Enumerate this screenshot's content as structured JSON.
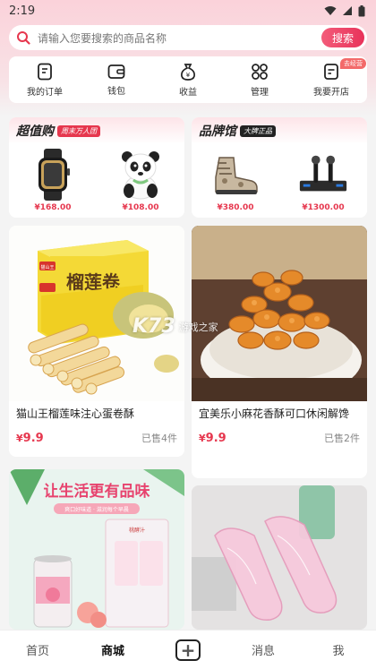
{
  "status": {
    "time": "2:19"
  },
  "search": {
    "placeholder": "请输入您要搜索的商品名称",
    "button": "搜索"
  },
  "menu": [
    {
      "label": "我的订单",
      "icon": "order-icon"
    },
    {
      "label": "钱包",
      "icon": "wallet-icon"
    },
    {
      "label": "收益",
      "icon": "money-bag-icon"
    },
    {
      "label": "管理",
      "icon": "grid-icon"
    },
    {
      "label": "我要开店",
      "icon": "shop-icon",
      "badge": "去经营"
    }
  ],
  "promos": [
    {
      "title": "超值购",
      "tag": "周末万人团",
      "items": [
        {
          "name": "smartwatch",
          "price": "¥168.00"
        },
        {
          "name": "panda-plush",
          "price": "¥108.00"
        }
      ]
    },
    {
      "title": "品牌馆",
      "tag": "大牌正品",
      "items": [
        {
          "name": "boots",
          "price": "¥380.00"
        },
        {
          "name": "microphone-set",
          "price": "¥1300.00"
        }
      ]
    }
  ],
  "products": [
    {
      "title": "猫山王榴莲味注心蛋卷酥",
      "price_symbol": "¥",
      "price": "9.9",
      "sold": "已售4件",
      "box_text": "榴莲卷",
      "brand_mark": "猫山王"
    },
    {
      "title": "宜美乐小麻花香酥可口休闲解馋",
      "price_symbol": "¥",
      "price": "9.9",
      "sold": "已售2件"
    },
    {
      "banner": "让生活更有品味",
      "tagline": "爽口好味道 · 滋润每个早晨",
      "can_brand": "桃酵汁"
    },
    {}
  ],
  "watermark": {
    "logo": "K73",
    "text": "游戏之家"
  },
  "tabs": [
    {
      "label": "首页"
    },
    {
      "label": "商城",
      "active": true
    },
    {
      "label": "+"
    },
    {
      "label": "消息"
    },
    {
      "label": "我"
    }
  ],
  "colors": {
    "accent": "#e6374e",
    "top_bg": "#fbd2da"
  }
}
